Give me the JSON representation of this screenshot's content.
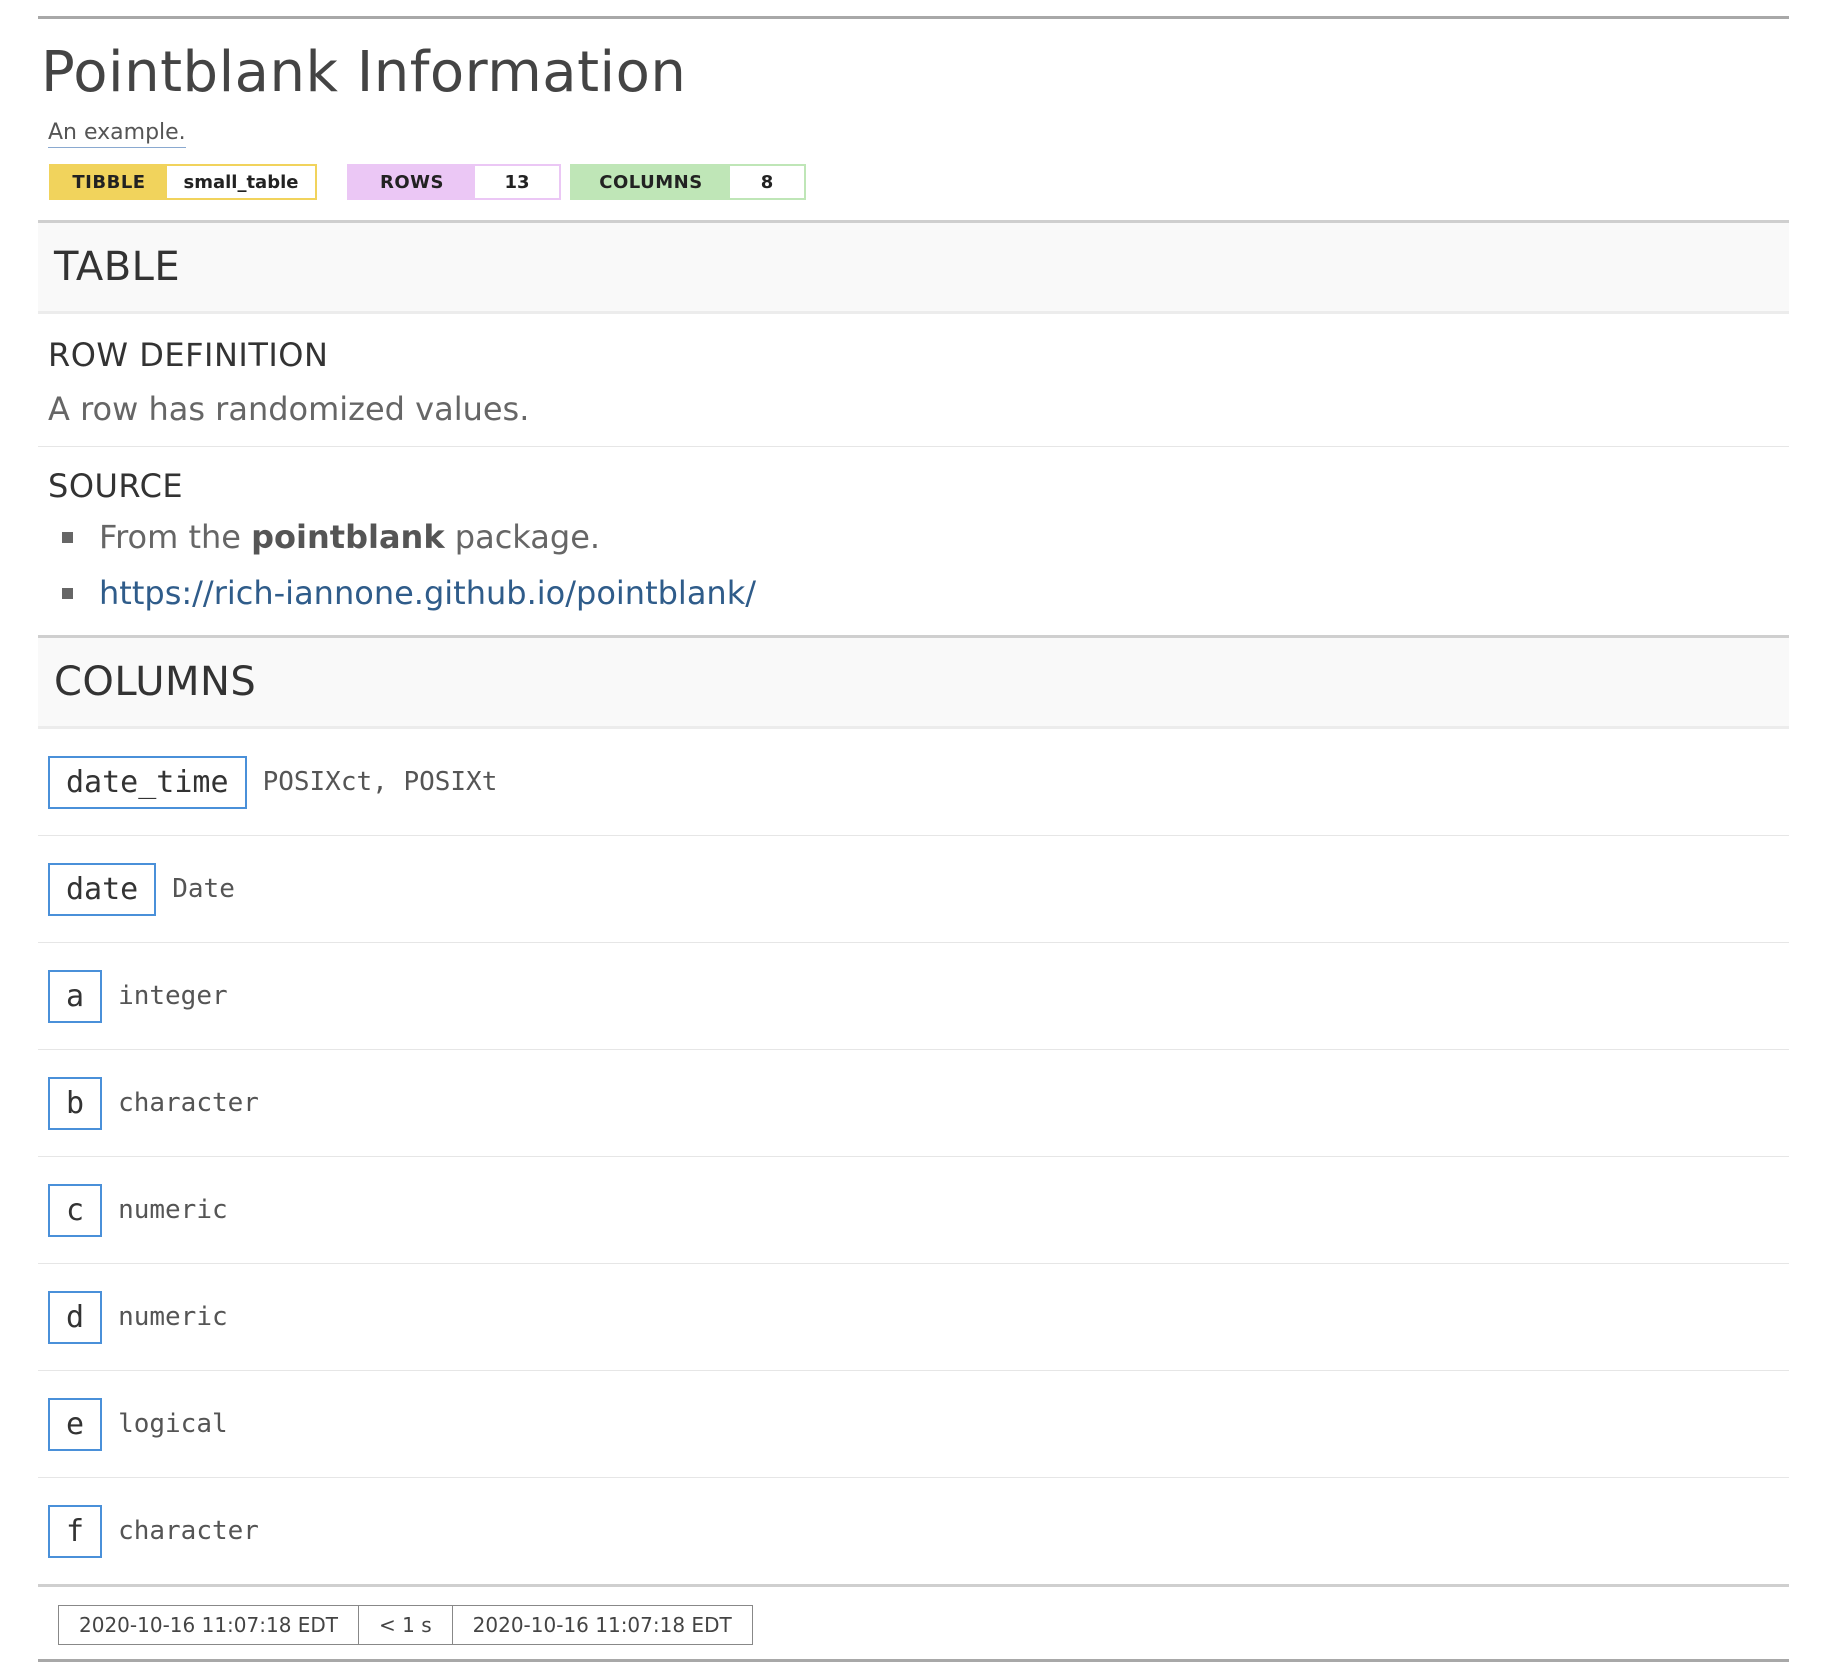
{
  "title": "Pointblank Information",
  "subtitle": "An example.",
  "badges": [
    {
      "key": "TIBBLE",
      "value": "small_table",
      "color": "#f1d35c"
    },
    {
      "key": "ROWS",
      "value": "13",
      "color": "#ebc7f5"
    },
    {
      "key": "COLUMNS",
      "value": "8",
      "color": "#bfe6b7"
    }
  ],
  "table_section": {
    "heading": "TABLE",
    "row_definition": {
      "title": "ROW DEFINITION",
      "text": "A row has randomized values."
    },
    "source": {
      "title": "SOURCE",
      "item1_prefix": "From the ",
      "item1_bold": "pointblank",
      "item1_suffix": " package.",
      "item2_link": "https://rich-iannone.github.io/pointblank/"
    }
  },
  "columns_section": {
    "heading": "COLUMNS",
    "columns": [
      {
        "name": "date_time",
        "type": "POSIXct, POSIXt"
      },
      {
        "name": "date",
        "type": "Date"
      },
      {
        "name": "a",
        "type": "integer"
      },
      {
        "name": "b",
        "type": "character"
      },
      {
        "name": "c",
        "type": "numeric"
      },
      {
        "name": "d",
        "type": "numeric"
      },
      {
        "name": "e",
        "type": "logical"
      },
      {
        "name": "f",
        "type": "character"
      }
    ]
  },
  "footer": {
    "start_time": "2020-10-16 11:07:18 EDT",
    "duration": "< 1 s",
    "end_time": "2020-10-16 11:07:18 EDT"
  },
  "colors": {
    "column_border": "#4a90d9",
    "link": "#2f5c8a"
  }
}
